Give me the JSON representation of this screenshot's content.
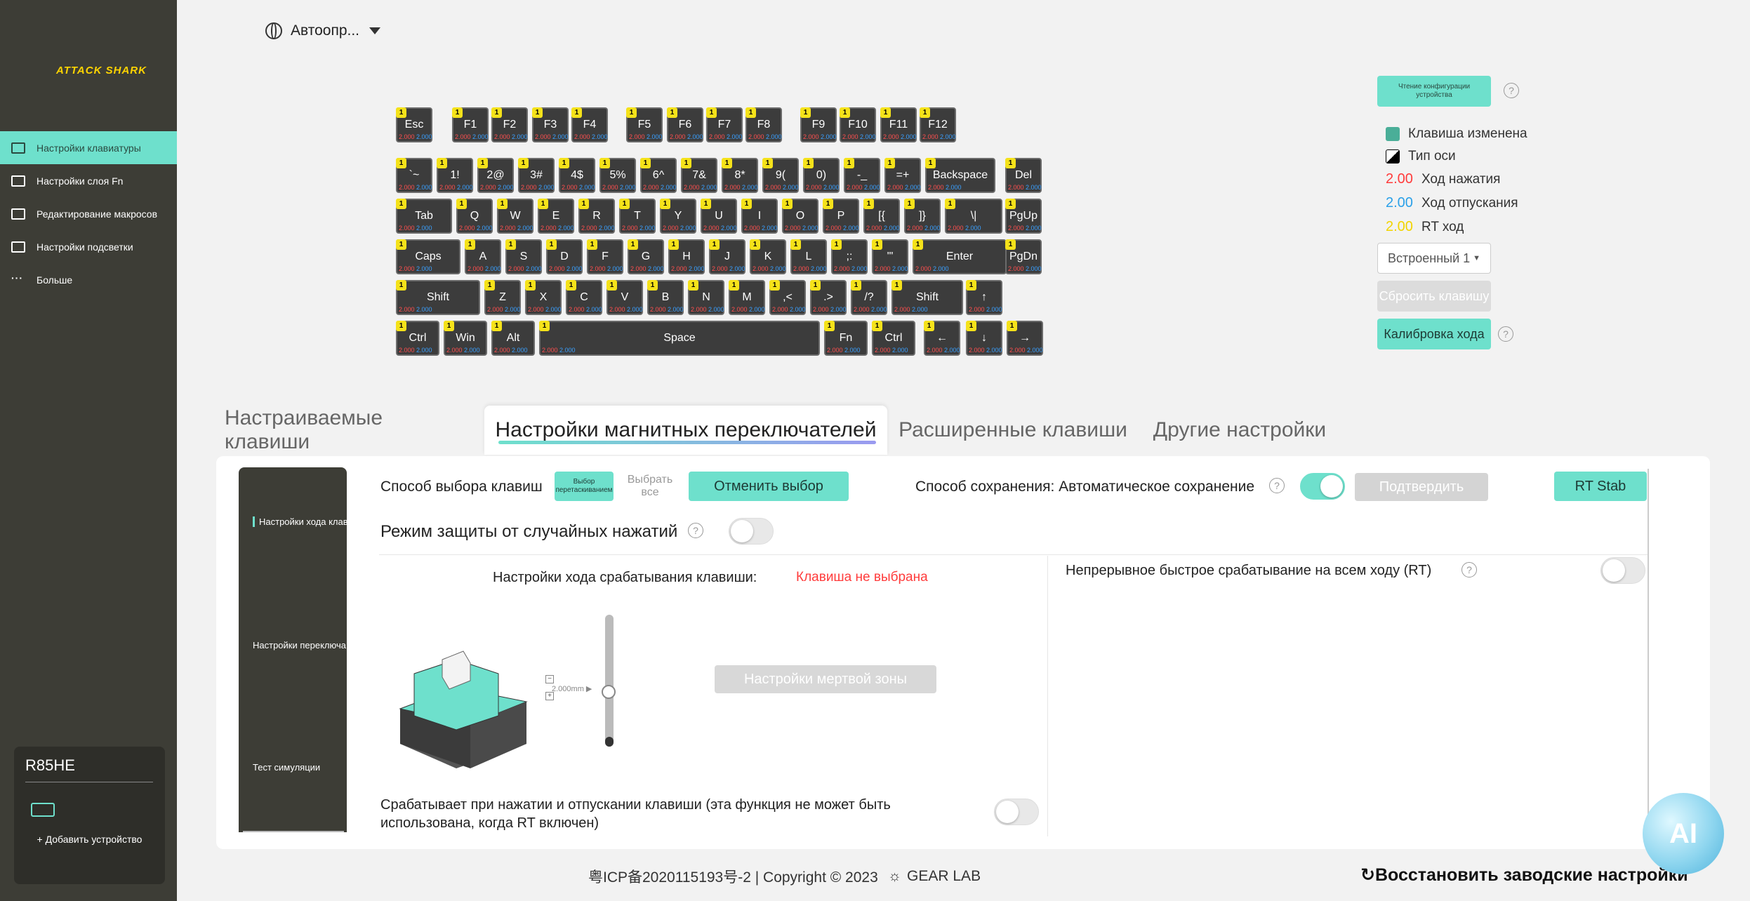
{
  "sidebar": {
    "logo": {
      "a": "ATTACK",
      "b": " SHARK"
    },
    "items": [
      {
        "label": "Настройки клавиатуры",
        "icon": "keyboard-settings-icon",
        "active": true
      },
      {
        "label": "Настройки слоя Fn",
        "icon": "fn-icon",
        "active": false
      },
      {
        "label": "Редактирование макросов",
        "icon": "macro-icon",
        "active": false
      },
      {
        "label": "Настройки подсветки",
        "icon": "light-icon",
        "active": false
      },
      {
        "label": "Больше",
        "icon": "more-icon",
        "active": false
      }
    ],
    "device": {
      "name": "R85HE",
      "add": "+ Добавить устройство"
    }
  },
  "topbar": {
    "language": "Автоопр..."
  },
  "legend": {
    "read_config": "Чтение конфигурации устройства",
    "key_changed": "Клавиша изменена",
    "axis_type": "Тип оси",
    "press_value": "2.00",
    "press_label": "Ход нажатия",
    "release_value": "2.00",
    "release_label": "Ход отпускания",
    "rt_value": "2.00",
    "rt_label": "RT ход",
    "preset": "Встроенный 1",
    "reset_key": "Сбросить клавишу",
    "calibrate": "Калибровка хода",
    "colors": {
      "accent": "#6ee0cc",
      "press": "#ff3b3b",
      "release": "#2aa0e8",
      "rt": "#f2d400"
    }
  },
  "keyboard": {
    "badge": "1",
    "press": "2.000",
    "release": "2.000",
    "rows": [
      [
        "Esc",
        "F1",
        "F2",
        "F3",
        "F4",
        "F5",
        "F6",
        "F7",
        "F8",
        "F9",
        "F10",
        "F11",
        "F12"
      ],
      [
        "`~",
        "1!",
        "2@",
        "3#",
        "4$",
        "5%",
        "6^",
        "7&",
        "8*",
        "9(",
        "0)",
        "-_",
        "=+",
        "Backspace",
        "Del"
      ],
      [
        "Tab",
        "Q",
        "W",
        "E",
        "R",
        "T",
        "Y",
        "U",
        "I",
        "O",
        "P",
        "[{",
        "]}",
        "\\|",
        "PgUp"
      ],
      [
        "Caps",
        "A",
        "S",
        "D",
        "F",
        "G",
        "H",
        "J",
        "K",
        "L",
        ";:",
        "'\"",
        "Enter",
        "PgDn"
      ],
      [
        "Shift",
        "Z",
        "X",
        "C",
        "V",
        "B",
        "N",
        "M",
        ",<",
        ".>",
        "/?",
        "Shift",
        "↑"
      ],
      [
        "Ctrl",
        "Win",
        "Alt",
        "Space",
        "Fn",
        "Ctrl",
        "←",
        "↓",
        "→"
      ]
    ]
  },
  "tabs": [
    {
      "label": "Настраиваемые клавиши",
      "active": false
    },
    {
      "label": "Настройки магнитных переключателей",
      "active": true
    },
    {
      "label": "Расширенные клавиши",
      "active": false
    },
    {
      "label": "Другие настройки",
      "active": false
    }
  ],
  "inner_nav": [
    "Настройки хода клав",
    "Настройки переключа",
    "Тест симуляции"
  ],
  "panel": {
    "select_mode_label": "Способ выбора клавиш",
    "select_multi": "Выбор перетаскиванием",
    "select_all": "Выбрать все",
    "cancel_select": "Отменить выбор",
    "save_mode": "Способ сохранения: Автоматическое сохранение",
    "auto_save_on": true,
    "confirm": "Подтвердить",
    "rt_stab": "RT Stab",
    "anti_mistouch": "Режим защиты от случайных нажатий",
    "trigger_label": "Настройки хода срабатывания клавиши:",
    "no_key": "Клавиша не выбрана",
    "slider_value": "2.000mm",
    "dead_zone": "Настройки мертвой зоны",
    "press_release_text": "Срабатывает при нажатии и отпускании клавиши (эта функция не может быть использована, когда RT включен)",
    "continuous_rt": "Непрерывное быстрое срабатывание на всем ходу (RT)"
  },
  "footer": {
    "icp": "粤ICP备2020115193号-2 | Copyright © 2023",
    "brand": "GEAR LAB",
    "restore": "Восстановить заводские настройки"
  },
  "ai_label": "AI"
}
